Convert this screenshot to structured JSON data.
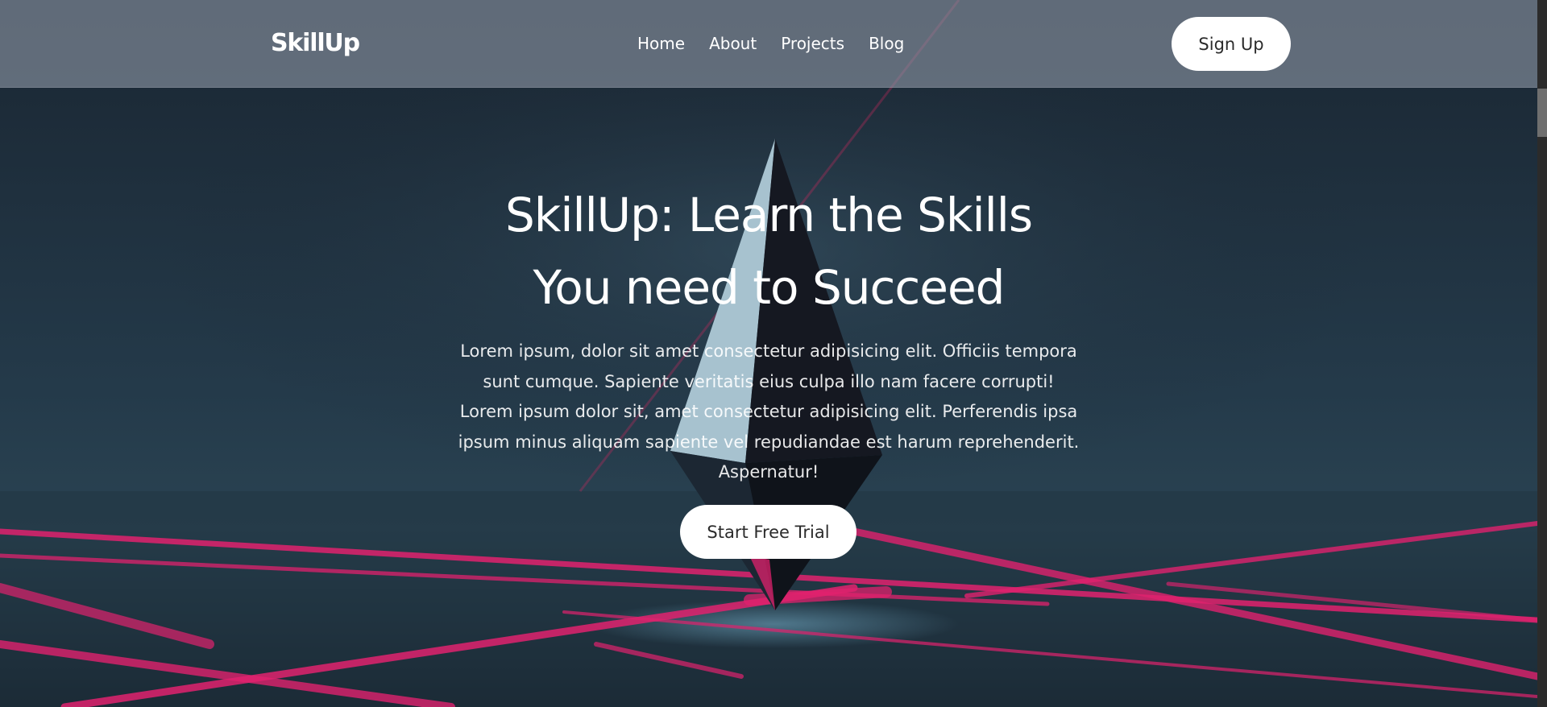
{
  "brand": {
    "name": "SkillUp"
  },
  "nav": {
    "items": [
      {
        "label": "Home"
      },
      {
        "label": "About"
      },
      {
        "label": "Projects"
      },
      {
        "label": "Blog"
      }
    ],
    "signup_label": "Sign Up"
  },
  "hero": {
    "title_line1": "SkillUp: Learn the Skills",
    "title_line2": "You need to Succeed",
    "description": "Lorem ipsum, dolor sit amet consectetur adipisicing elit. Officiis tempora sunt cumque. Sapiente veritatis eius culpa illo nam facere corrupti! Lorem ipsum dolor sit, amet consectetur adipisicing elit. Perferendis ipsa ipsum minus aliquam sapiente vel repudiandae est harum reprehenderit. Aspernatur!",
    "cta_label": "Start Free Trial"
  },
  "colors": {
    "accent_pink": "#e0226e",
    "background": "#1f3040",
    "button_bg": "#ffffff"
  }
}
